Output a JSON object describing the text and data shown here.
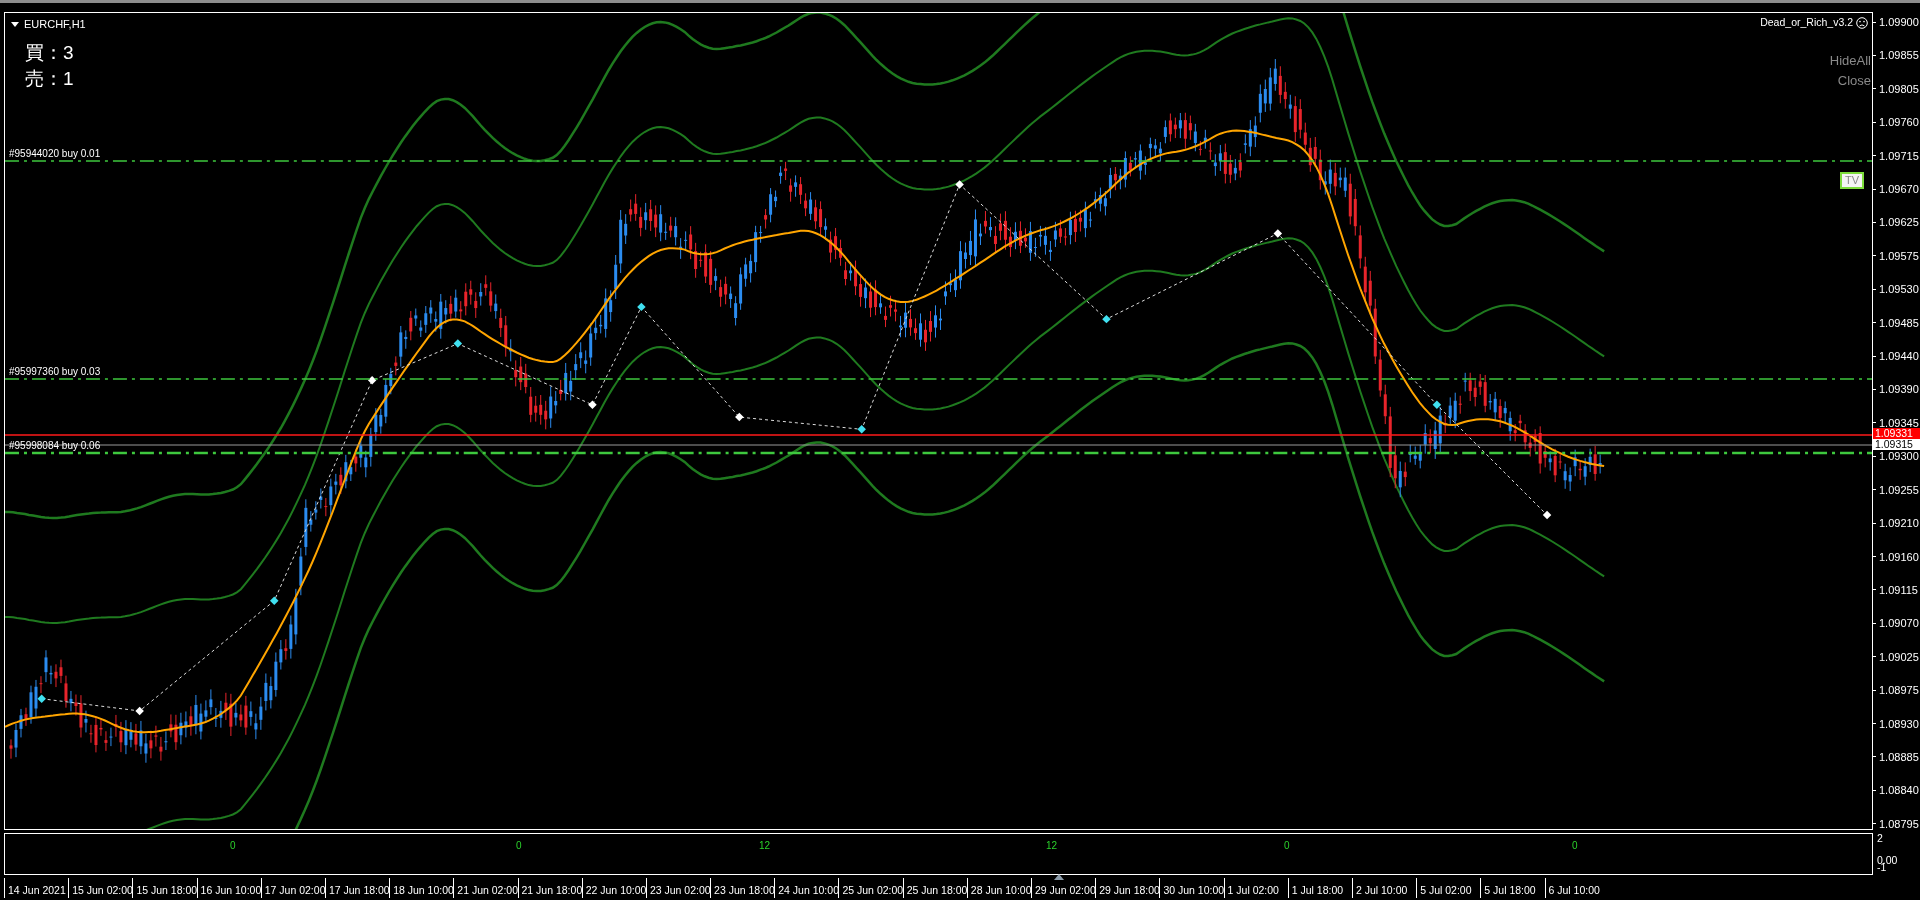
{
  "chart": {
    "title": "EURCHF,H1",
    "expert": "Dead_or_Rich_v3.2",
    "position_counts": [
      "買：3",
      "売：1"
    ],
    "panel_buttons": [
      {
        "label": "HideAll"
      },
      {
        "label": "Close"
      }
    ],
    "tv_button": {
      "label": "TV"
    },
    "order_lines": [
      {
        "label": "#95944020 buy 0.01"
      },
      {
        "label": "#95997360 buy 0.03"
      },
      {
        "label": "#95998084 buy 0.06"
      }
    ],
    "price_axis": {
      "ticks": [
        "1.09900",
        "1.09855",
        "1.09805",
        "1.09760",
        "1.09715",
        "1.09670",
        "1.09625",
        "1.09575",
        "1.09530",
        "1.09485",
        "1.09440",
        "1.09390",
        "1.09345",
        "1.09300",
        "1.09255",
        "1.09210",
        "1.09160",
        "1.09115",
        "1.09070",
        "1.09025",
        "1.08975",
        "1.08930",
        "1.08885",
        "1.08840",
        "1.08795"
      ],
      "bid_tag": "1.09331",
      "last_tag": "1.09315"
    },
    "indicator": {
      "scale": [
        "2",
        "0.00",
        "-1"
      ],
      "labels": [
        "0",
        "0",
        "12",
        "12",
        "0",
        "0"
      ]
    },
    "time_axis": [
      "14 Jun 2021",
      "15 Jun 02:00",
      "15 Jun 18:00",
      "16 Jun 10:00",
      "17 Jun 02:00",
      "17 Jun 18:00",
      "18 Jun 10:00",
      "21 Jun 02:00",
      "21 Jun 18:00",
      "22 Jun 10:00",
      "23 Jun 02:00",
      "23 Jun 18:00",
      "24 Jun 10:00",
      "25 Jun 02:00",
      "25 Jun 18:00",
      "28 Jun 10:00",
      "29 Jun 02:00",
      "29 Jun 18:00",
      "30 Jun 10:00",
      "1 Jul 02:00",
      "1 Jul 18:00",
      "2 Jul 10:00",
      "5 Jul 02:00",
      "5 Jul 18:00",
      "6 Jul 10:00"
    ]
  }
}
